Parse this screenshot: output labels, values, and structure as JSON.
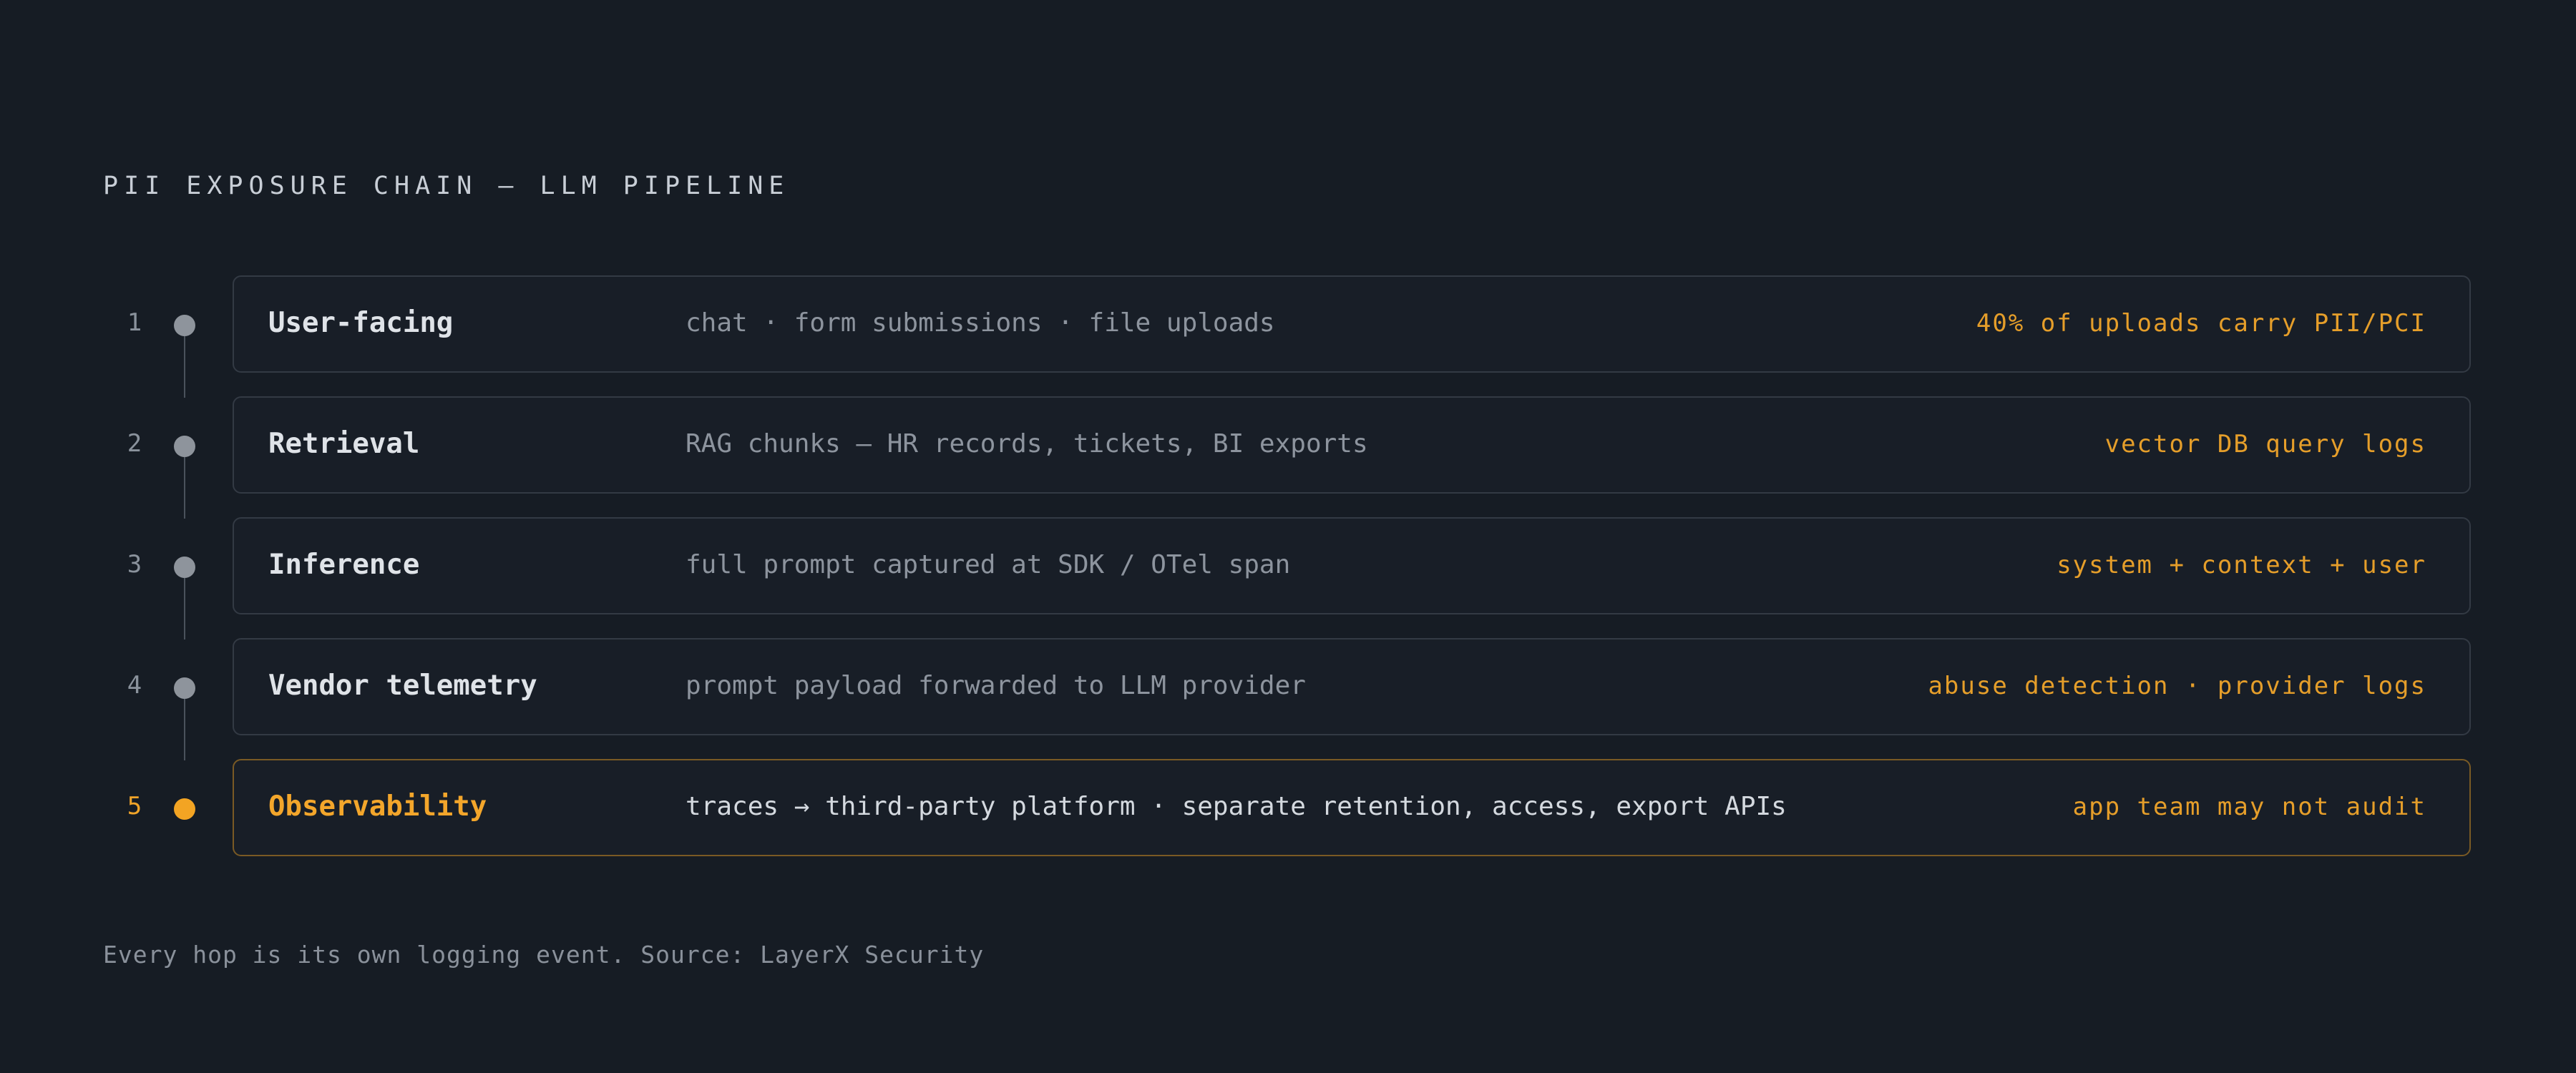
{
  "title": "PII EXPOSURE CHAIN — LLM PIPELINE",
  "colors": {
    "background": "#161c24",
    "accent": "#f3a423",
    "node_default": "#8e949c"
  },
  "steps": [
    {
      "number": "1",
      "name": "User-facing",
      "description": "chat · form submissions · file uploads",
      "tag": "40% of uploads carry PII/PCI",
      "highlighted": false
    },
    {
      "number": "2",
      "name": "Retrieval",
      "description": "RAG chunks — HR records, tickets, BI exports",
      "tag": "vector DB query logs",
      "highlighted": false
    },
    {
      "number": "3",
      "name": "Inference",
      "description": "full prompt captured at SDK / OTel span",
      "tag": "system + context + user",
      "highlighted": false
    },
    {
      "number": "4",
      "name": "Vendor telemetry",
      "description": "prompt payload forwarded to LLM provider",
      "tag": "abuse detection · provider logs",
      "highlighted": false
    },
    {
      "number": "5",
      "name": "Observability",
      "description": "traces → third-party platform · separate retention, access, export APIs",
      "tag": "app team may not audit",
      "highlighted": true
    }
  ],
  "footnote": "Every hop is its own logging event. Source: LayerX Security"
}
